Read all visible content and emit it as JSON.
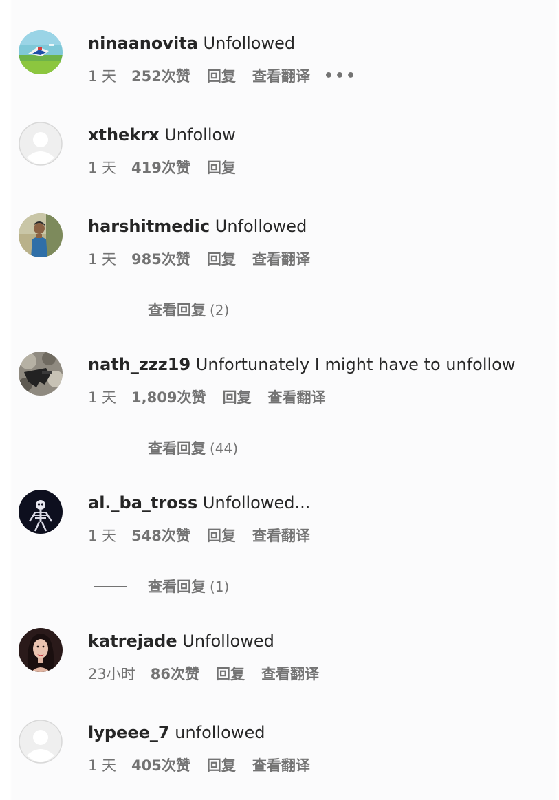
{
  "comments": [
    {
      "username": "ninaanovita",
      "text": "Unfollowed",
      "time": "1 天",
      "likes": "252次赞",
      "reply": "回复",
      "translate": "查看翻译",
      "more": "•••",
      "avatar": "landscape-photo"
    },
    {
      "username": "xthekrx",
      "text": "Unfollow",
      "time": "1 天",
      "likes": "419次赞",
      "reply": "回复",
      "avatar": "default-profile"
    },
    {
      "username": "harshitmedic",
      "text": "Unfollowed",
      "time": "1 天",
      "likes": "985次赞",
      "reply": "回复",
      "translate": "查看翻译",
      "avatar": "person-photo",
      "view_replies": {
        "label": "查看回复",
        "count": "(2)"
      }
    },
    {
      "username": "nath_zzz19",
      "text": "Unfortunately I might have to unfollow",
      "time": "1 天",
      "likes": "1,809次赞",
      "reply": "回复",
      "translate": "查看翻译",
      "avatar": "camo-photo",
      "view_replies": {
        "label": "查看回复",
        "count": "(44)"
      }
    },
    {
      "username": "al._ba_tross",
      "text": "Unfollowed...",
      "time": "1 天",
      "likes": "548次赞",
      "reply": "回复",
      "translate": "查看翻译",
      "avatar": "skeleton-photo",
      "view_replies": {
        "label": "查看回复",
        "count": "(1)"
      }
    },
    {
      "username": "katrejade",
      "text": "Unfollowed",
      "time": "23小时",
      "likes": "86次赞",
      "reply": "回复",
      "translate": "查看翻译",
      "avatar": "portrait-photo"
    },
    {
      "username": "lypeee_7",
      "text": "unfollowed",
      "time": "1 天",
      "likes": "405次赞",
      "reply": "回复",
      "translate": "查看翻译",
      "avatar": "default-profile"
    }
  ],
  "colors": {
    "text": "#262626",
    "secondary": "#737373",
    "background": "#fbfbfc"
  }
}
